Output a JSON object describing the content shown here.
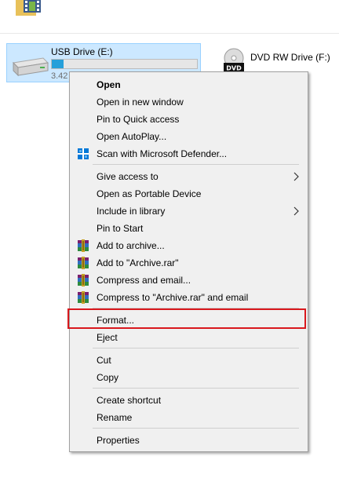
{
  "colors": {
    "selection_bg": "#cce8ff",
    "selection_border": "#99d1ff",
    "drive_bar": "#26a0da",
    "menu_bg": "#f0f0f0",
    "highlight_red": "#d9181d",
    "defender_blue": "#0078d7"
  },
  "drives": {
    "usb": {
      "name": "USB Drive (E:)",
      "free_text": "3.42",
      "used_fraction": 0.08,
      "icon": "usb-drive-icon"
    },
    "dvd": {
      "name": "DVD RW Drive (F:)",
      "icon_label": "DVD",
      "icon": "dvd-drive-icon"
    }
  },
  "menu": {
    "open": "Open",
    "open_new_window": "Open in new window",
    "pin_quick_access": "Pin to Quick access",
    "open_autoplay": "Open AutoPlay...",
    "scan_defender": "Scan with Microsoft Defender...",
    "give_access": "Give access to",
    "open_portable": "Open as Portable Device",
    "include_library": "Include in library",
    "pin_start": "Pin to Start",
    "add_archive": "Add to archive...",
    "add_archive_rar": "Add to \"Archive.rar\"",
    "compress_email": "Compress and email...",
    "compress_rar_email": "Compress to \"Archive.rar\" and email",
    "format": "Format...",
    "eject": "Eject",
    "cut": "Cut",
    "copy": "Copy",
    "create_shortcut": "Create shortcut",
    "rename": "Rename",
    "properties": "Properties"
  }
}
